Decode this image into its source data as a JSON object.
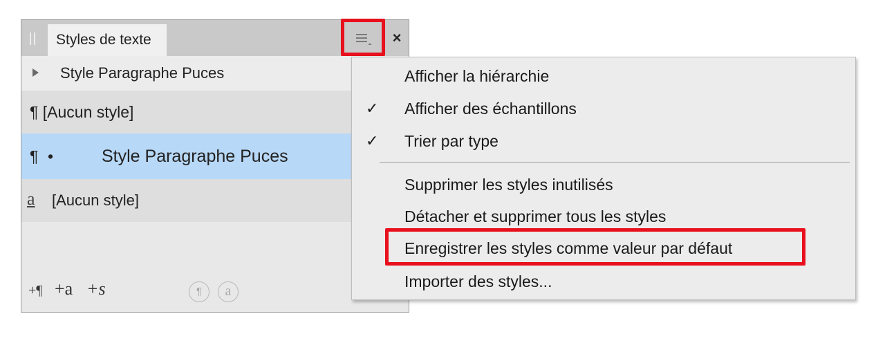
{
  "panel": {
    "tab_title": "Styles de texte",
    "close_glyph": "×",
    "styles": [
      {
        "label": "Style Paragraphe Puces",
        "kind": "group"
      },
      {
        "icon": "¶",
        "label": "[Aucun style]",
        "kind": "paragraph"
      },
      {
        "icon": "¶",
        "bullet": "•",
        "label": "Style Paragraphe Puces",
        "kind": "paragraph",
        "selected": true
      },
      {
        "icon": "a",
        "label": "[Aucun style]",
        "kind": "character"
      }
    ],
    "footer": {
      "new_paragraph": "+¶",
      "new_character": "+a",
      "new_style": "+s",
      "para_circle": "¶",
      "char_circle": "a"
    }
  },
  "menu": {
    "items": [
      {
        "label": "Afficher la hiérarchie",
        "checked": false
      },
      {
        "label": "Afficher des échantillons",
        "checked": true,
        "check_glyph": "✓"
      },
      {
        "label": "Trier par type",
        "checked": true,
        "check_glyph": "✓"
      },
      {
        "label": "Supprimer les styles inutilisés"
      },
      {
        "label": "Détacher et supprimer tous les styles"
      },
      {
        "label": "Enregistrer les styles comme valeur par défaut",
        "highlighted": true
      },
      {
        "label": "Importer des styles..."
      }
    ]
  },
  "colors": {
    "highlight_red": "#e8101d",
    "selection_blue": "#b8d8f7",
    "panel_bg": "#e8e8e8",
    "menu_bg": "#ececec"
  }
}
